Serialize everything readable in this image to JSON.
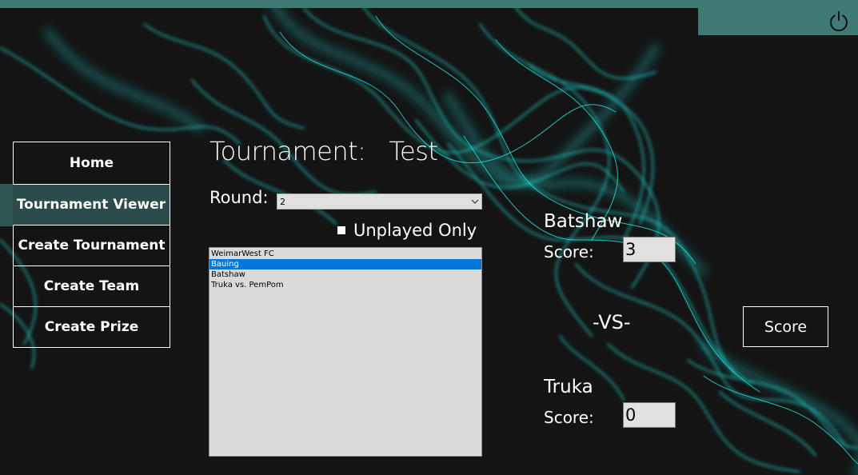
{
  "colors": {
    "accent": "#3f7a74",
    "background": "#141414",
    "smoke": "#1fd6d0",
    "selection": "#0078d7"
  },
  "header": {
    "power_icon": "power-icon"
  },
  "nav": {
    "items": [
      {
        "label": "Home",
        "active": false
      },
      {
        "label": "Tournament Viewer",
        "active": true
      },
      {
        "label": "Create Tournament",
        "active": false
      },
      {
        "label": "Create Team",
        "active": false
      },
      {
        "label": "Create Prize",
        "active": false
      }
    ]
  },
  "tournament": {
    "title": "Tournament:   Test",
    "round_label": "Round:",
    "round_value": "2",
    "unplayed_label": "Unplayed Only",
    "unplayed_checked": true,
    "matchups": [
      {
        "label": "WeimarWest FC",
        "selected": false
      },
      {
        "label": "Bauing",
        "selected": true
      },
      {
        "label": "Batshaw",
        "selected": false
      },
      {
        "label": "Truka vs. PemPom",
        "selected": false
      }
    ]
  },
  "match": {
    "team_one": {
      "name": "Batshaw",
      "score_label": "Score:",
      "score": "3"
    },
    "vs_label": "-VS-",
    "team_two": {
      "name": "Truka",
      "score_label": "Score:",
      "score": "0"
    },
    "score_button": "Score"
  }
}
